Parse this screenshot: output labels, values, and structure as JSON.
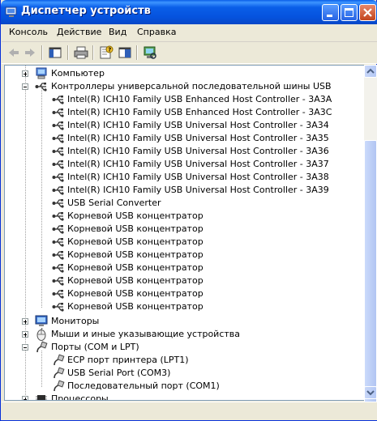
{
  "window": {
    "title": "Диспетчер устройств"
  },
  "menu": [
    "Консоль",
    "Действие",
    "Вид",
    "Справка"
  ],
  "toolbar": [
    "back-icon",
    "forward-icon",
    "show-hide-tree-icon",
    "print-icon",
    "properties-icon",
    "help-icon",
    "scan-hardware-icon"
  ],
  "tree": {
    "computer": "Компьютер",
    "usb_controllers": "Контроллеры универсальной последовательной шины USB",
    "usb_items": [
      "Intel(R) ICH10 Family USB Enhanced Host Controller - 3A3A",
      "Intel(R) ICH10 Family USB Enhanced Host Controller - 3A3C",
      "Intel(R) ICH10 Family USB Universal Host Controller - 3A34",
      "Intel(R) ICH10 Family USB Universal Host Controller - 3A35",
      "Intel(R) ICH10 Family USB Universal Host Controller - 3A36",
      "Intel(R) ICH10 Family USB Universal Host Controller - 3A37",
      "Intel(R) ICH10 Family USB Universal Host Controller - 3A38",
      "Intel(R) ICH10 Family USB Universal Host Controller - 3A39",
      "USB Serial Converter",
      "Корневой USB концентратор",
      "Корневой USB концентратор",
      "Корневой USB концентратор",
      "Корневой USB концентратор",
      "Корневой USB концентратор",
      "Корневой USB концентратор",
      "Корневой USB концентратор",
      "Корневой USB концентратор"
    ],
    "monitors": "Мониторы",
    "mice": "Мыши и иные указывающие устройства",
    "ports": "Порты (COM и LPT)",
    "port_items": [
      "ECP порт принтера (LPT1)",
      "USB Serial Port (COM3)",
      "Последовательный порт (COM1)"
    ],
    "processors": "Процессоры"
  }
}
